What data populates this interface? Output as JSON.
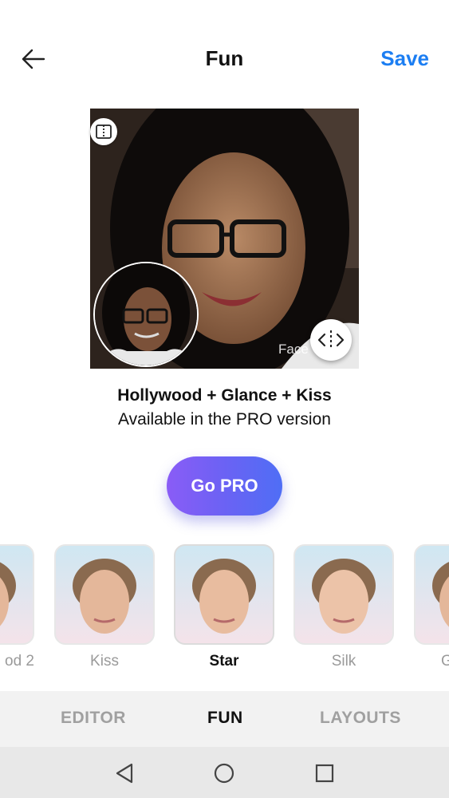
{
  "header": {
    "title": "Fun",
    "save_label": "Save"
  },
  "photo": {
    "watermark": "Face"
  },
  "filter_info": {
    "name": "Hollywood + Glance + Kiss",
    "availability": "Available in the PRO version"
  },
  "cta": {
    "label": "Go PRO"
  },
  "filters": [
    {
      "label": "od 2"
    },
    {
      "label": "Kiss"
    },
    {
      "label": "Star",
      "selected": true
    },
    {
      "label": "Silk"
    },
    {
      "label": "G"
    }
  ],
  "tabs": [
    {
      "label": "EDITOR"
    },
    {
      "label": "FUN",
      "active": true
    },
    {
      "label": "LAYOUTS"
    }
  ],
  "colors": {
    "accent": "#1c7ef2",
    "cta_start": "#8a5cf6",
    "cta_end": "#4f6ef5"
  },
  "icons": {
    "back": "arrow-left-icon",
    "split": "split-view-icon",
    "compare": "compare-arrows-icon",
    "nav_back": "triangle-back-icon",
    "nav_home": "circle-home-icon",
    "nav_recent": "square-recents-icon"
  }
}
